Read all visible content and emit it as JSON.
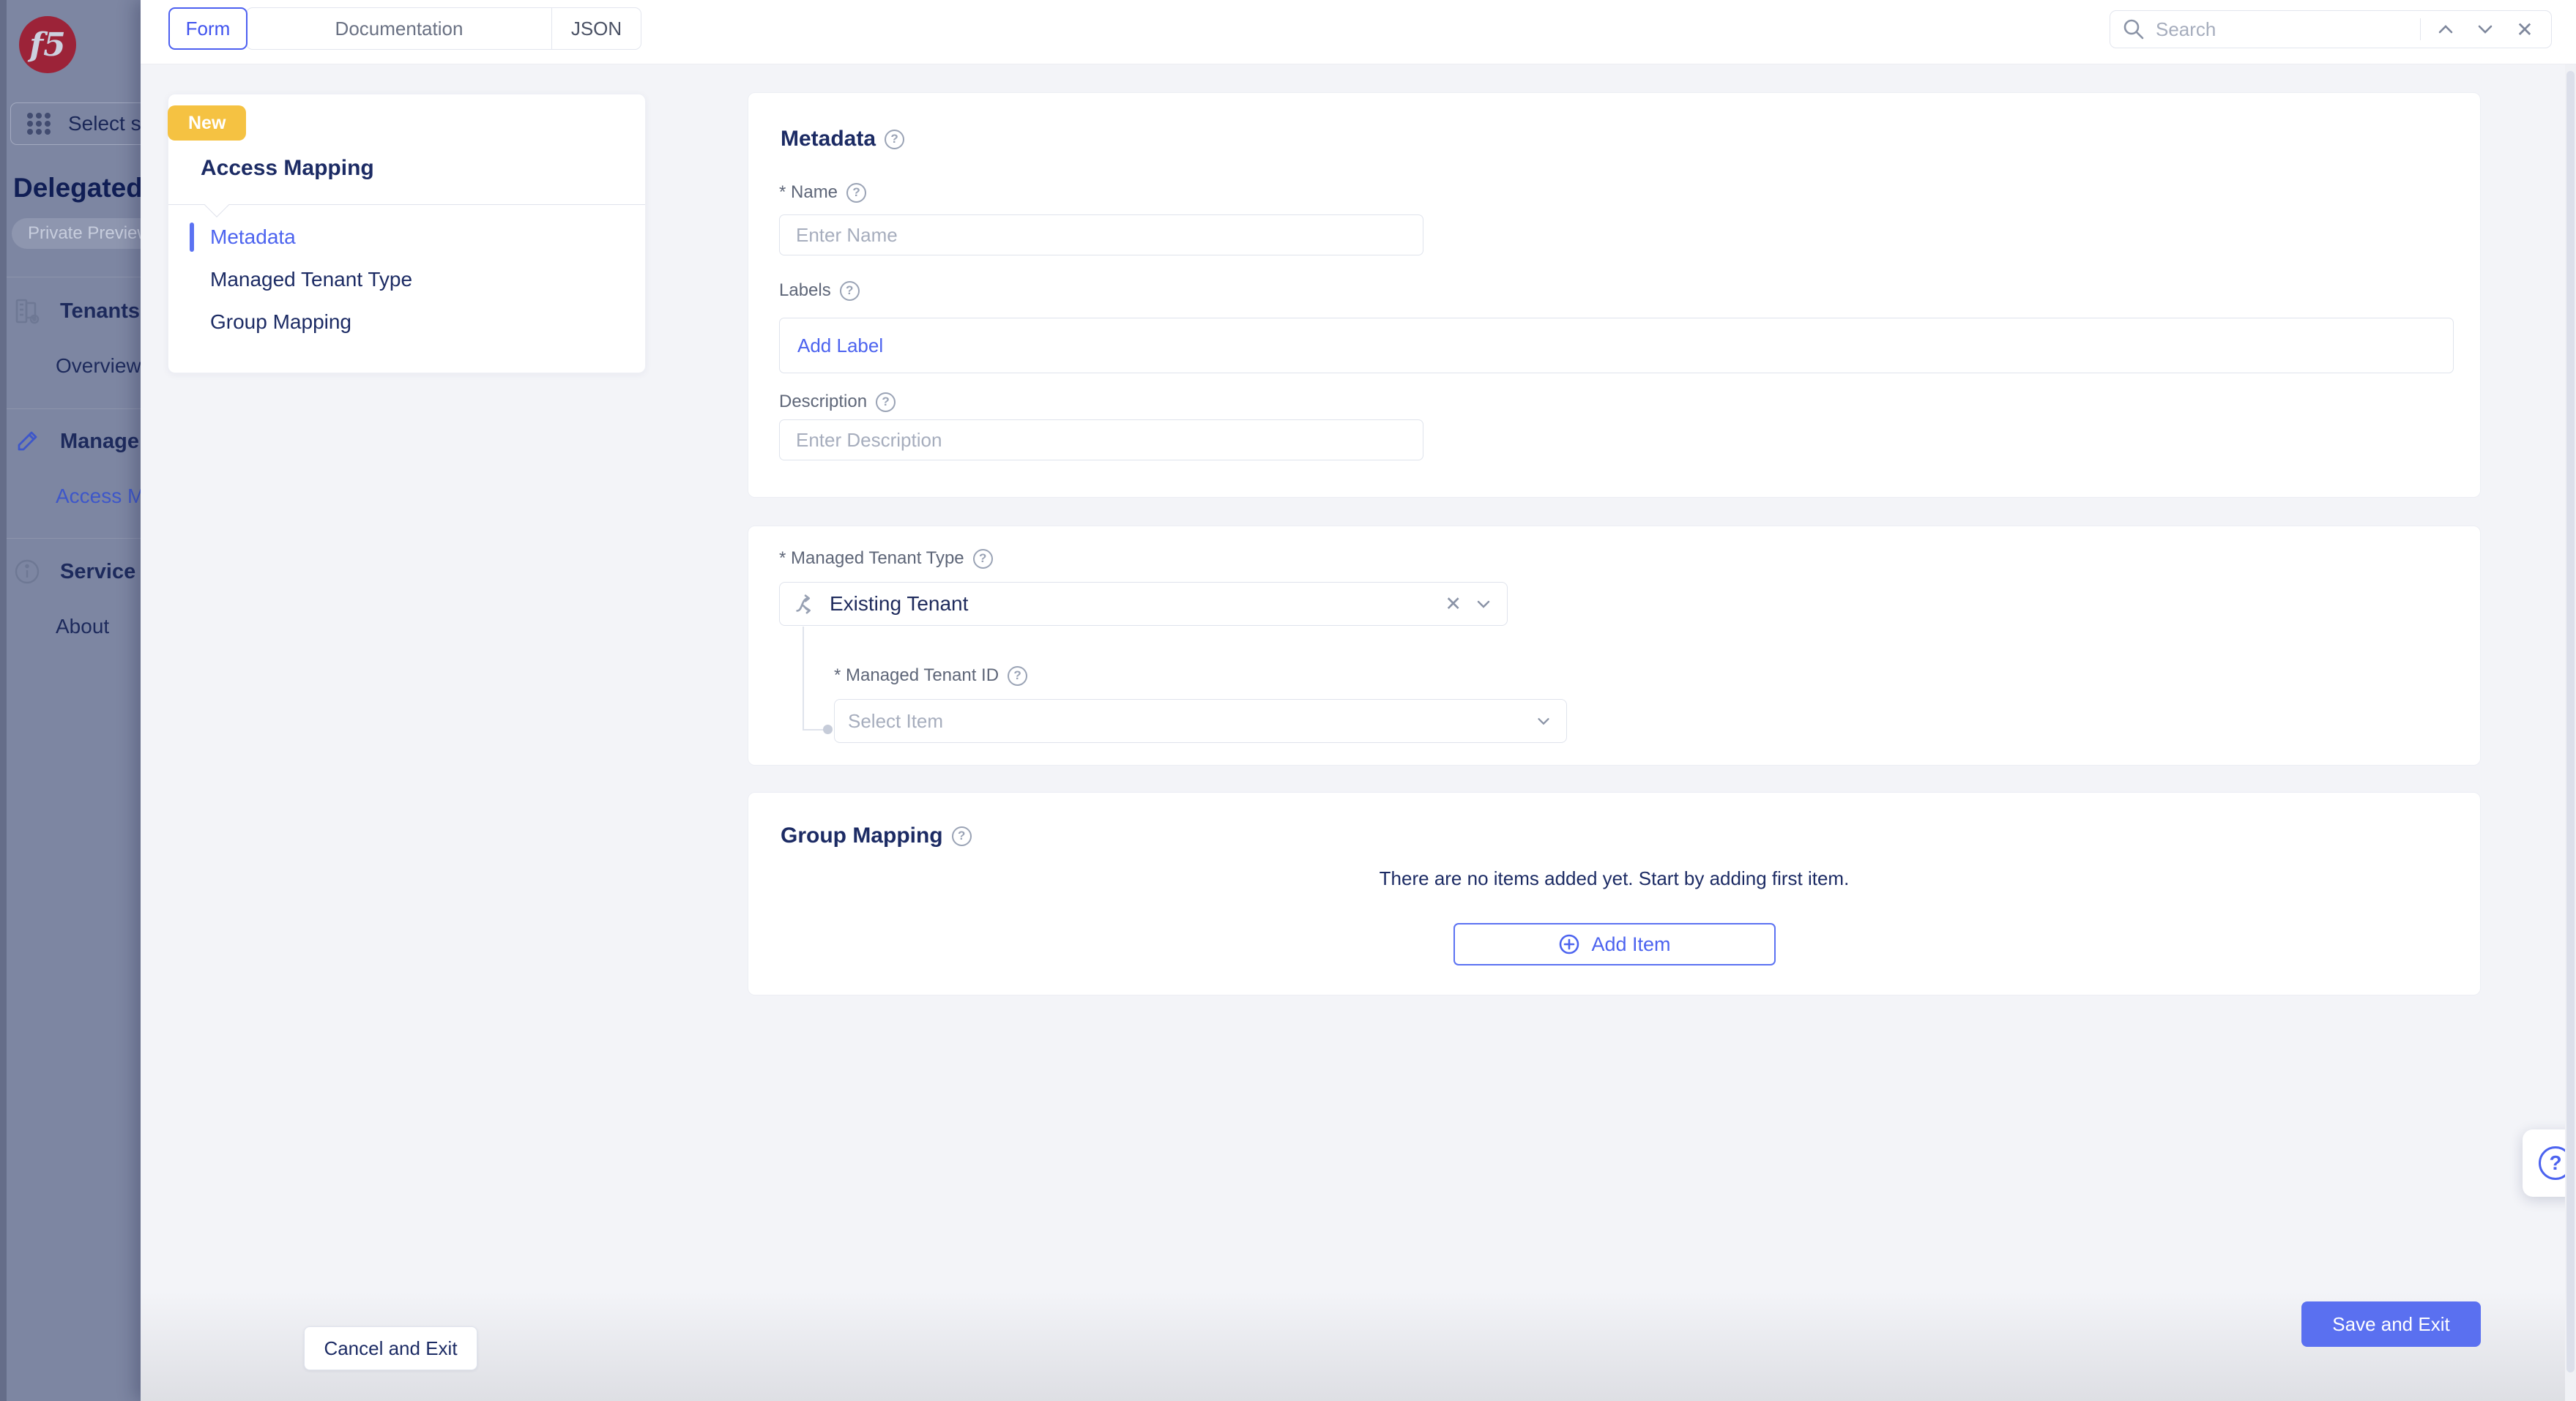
{
  "colors": {
    "accent": "#4c63ef",
    "save_button": "#5a70f0",
    "new_badge": "#f5c242",
    "navy": "#1c2b64",
    "sidebar_dim": "#7d86a2"
  },
  "icons": {
    "logo": "f5-logo",
    "grid": "app-grid-icon",
    "tenants": "buildings-gear-icon",
    "pencil": "pencil-icon",
    "info": "info-circle-icon",
    "search": "magnifier-icon",
    "up": "chevron-up-icon",
    "down": "chevron-down-icon",
    "close": "close-icon",
    "help": "question-circle-icon",
    "branch": "branch-select-icon",
    "plus": "plus-circle-icon"
  },
  "topbar": {
    "tabs": [
      {
        "label": "Form"
      },
      {
        "label": "Documentation"
      },
      {
        "label": "JSON"
      }
    ],
    "active_tab": "Form",
    "search": {
      "placeholder": "Search",
      "close_glyph": "✕"
    }
  },
  "sidebar": {
    "logo_text": "f5",
    "service_selector_label": "Select se",
    "page_title": "Delegated",
    "badge": "Private Preview",
    "sections": [
      {
        "label": "Tenants",
        "items": [
          {
            "label": "Overview"
          }
        ]
      },
      {
        "label": "Manage",
        "items": [
          {
            "label": "Access M"
          }
        ]
      },
      {
        "label": "Service",
        "items": [
          {
            "label": "About"
          }
        ]
      }
    ]
  },
  "wizard": {
    "badge": "New",
    "title": "Access Mapping",
    "active_nav": "Metadata",
    "nav": [
      {
        "label": "Metadata"
      },
      {
        "label": "Managed Tenant Type"
      },
      {
        "label": "Group Mapping"
      }
    ]
  },
  "form": {
    "metadata": {
      "title": "Metadata",
      "name_label": "* Name",
      "name_placeholder": "Enter Name",
      "labels_label": "Labels",
      "add_label_link": "Add Label",
      "description_label": "Description",
      "description_placeholder": "Enter Description"
    },
    "managed_tenant": {
      "type_label": "* Managed Tenant Type",
      "type_value": "Existing Tenant",
      "clear_glyph": "✕",
      "id_label": "* Managed Tenant ID",
      "id_placeholder": "Select Item"
    },
    "group_mapping": {
      "title": "Group Mapping",
      "empty_text": "There are no items added yet. Start by adding first item.",
      "add_item_label": "Add Item"
    },
    "help_glyph": "?",
    "footer": {
      "cancel": "Cancel and Exit",
      "save": "Save and Exit"
    }
  }
}
